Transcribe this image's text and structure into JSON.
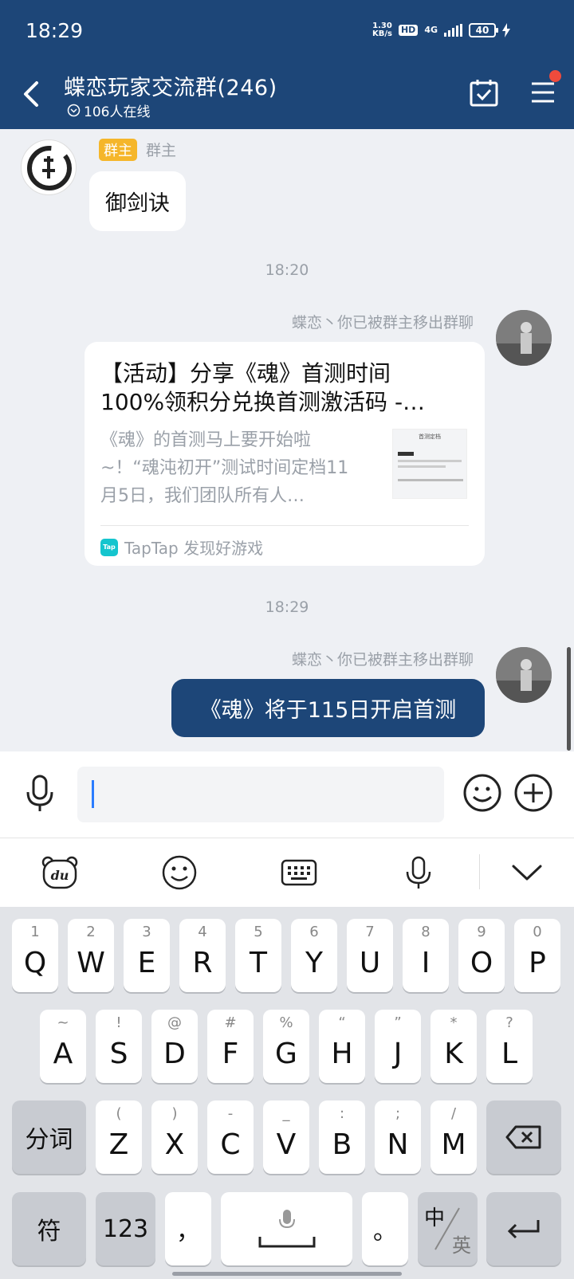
{
  "status": {
    "time": "18:29",
    "net_speed_top": "1.30",
    "net_speed_bottom": "KB/s",
    "hd": "HD",
    "network": "4G",
    "battery": "40"
  },
  "header": {
    "title": "蝶恋玩家交流群(246)",
    "online": "106人在线"
  },
  "chat": {
    "owner_tag": "群主",
    "owner_role": "群主",
    "owner_message": "御剑诀",
    "time1": "18:20",
    "sender1": "蝶恋丶你已被群主移出群聊",
    "card": {
      "title_line1": "【活动】分享《魂》首测时间",
      "title_line2": "100%领积分兑换首测激活码 -…",
      "desc": "《魂》的首测马上要开始啦~！“魂沌初开”测试时间定档11月5日，我们团队所有人…",
      "thumb_title": "首测定档",
      "source": "TapTap 发现好游戏",
      "source_icon_text": "Tap"
    },
    "time2": "18:29",
    "sender2": "蝶恋丶你已被群主移出群聊",
    "my_message": "《魂》将于115日开启首测"
  },
  "input": {
    "value": "",
    "placeholder": ""
  },
  "keyboard": {
    "row1": [
      {
        "hint": "1",
        "key": "Q"
      },
      {
        "hint": "2",
        "key": "W"
      },
      {
        "hint": "3",
        "key": "E"
      },
      {
        "hint": "4",
        "key": "R"
      },
      {
        "hint": "5",
        "key": "T"
      },
      {
        "hint": "6",
        "key": "Y"
      },
      {
        "hint": "7",
        "key": "U"
      },
      {
        "hint": "8",
        "key": "I"
      },
      {
        "hint": "9",
        "key": "O"
      },
      {
        "hint": "0",
        "key": "P"
      }
    ],
    "row2": [
      {
        "hint": "~",
        "key": "A"
      },
      {
        "hint": "!",
        "key": "S"
      },
      {
        "hint": "@",
        "key": "D"
      },
      {
        "hint": "#",
        "key": "F"
      },
      {
        "hint": "%",
        "key": "G"
      },
      {
        "hint": "“",
        "key": "H"
      },
      {
        "hint": "”",
        "key": "J"
      },
      {
        "hint": "*",
        "key": "K"
      },
      {
        "hint": "?",
        "key": "L"
      }
    ],
    "row3": [
      {
        "hint": "(",
        "key": "Z"
      },
      {
        "hint": ")",
        "key": "X"
      },
      {
        "hint": "-",
        "key": "C"
      },
      {
        "hint": "_",
        "key": "V"
      },
      {
        "hint": ":",
        "key": "B"
      },
      {
        "hint": ";",
        "key": "N"
      },
      {
        "hint": "/",
        "key": "M"
      }
    ],
    "fenci": "分词",
    "fu": "符",
    "num": "123",
    "comma": "，",
    "period": "。",
    "zhong": "中",
    "ying": "英"
  }
}
